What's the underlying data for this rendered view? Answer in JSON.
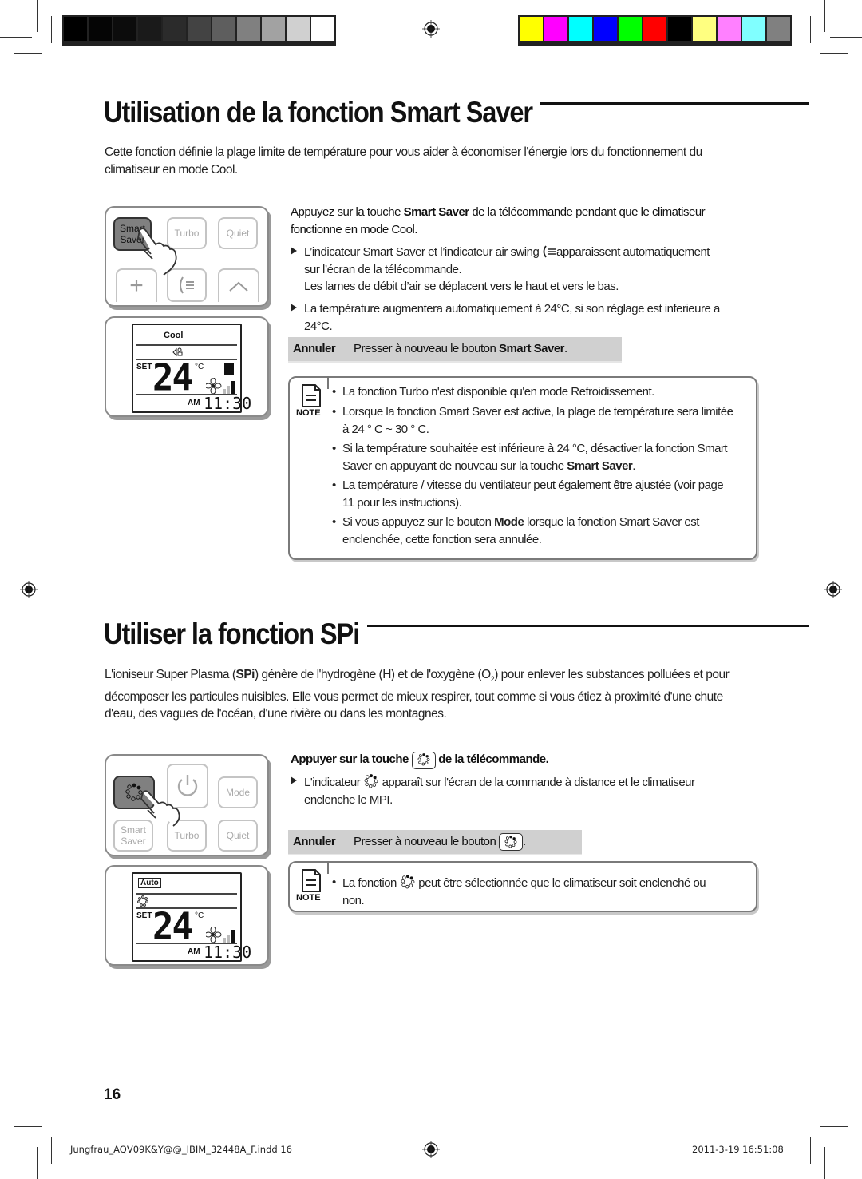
{
  "print_marks": {
    "grayscale_swatches": [
      "#000000",
      "#050505",
      "#0c0c0c",
      "#1a1a1a",
      "#2b2b2b",
      "#434343",
      "#5e5e5e",
      "#808080",
      "#a2a2a2",
      "#d0d0d0",
      "#ffffff"
    ],
    "color_swatches": [
      "#ffff00",
      "#ff00ff",
      "#00ffff",
      "#0000ff",
      "#00ff00",
      "#ff0000",
      "#000000",
      "#ffff80",
      "#ff80ff",
      "#80ffff",
      "#808080"
    ]
  },
  "section1": {
    "title": "Utilisation de la fonction Smart Saver",
    "intro_line1": "Cette fonction définie la plage limite de température pour vous aider à économiser l'énergie lors du fonctionnement du",
    "intro_line2": "climatiseur en mode Cool.",
    "remote": {
      "buttons": [
        {
          "label_line1": "Smart",
          "label_line2": "Saver",
          "pressed": true
        },
        {
          "label_line1": "Turbo",
          "label_line2": "",
          "pressed": false
        },
        {
          "label_line1": "Quiet",
          "label_line2": "",
          "pressed": false
        }
      ],
      "row2_icons": [
        "plus-icon",
        "air-swing-icon",
        "chevron-up-icon"
      ]
    },
    "display": {
      "mode": "Cool",
      "set_label": "SET",
      "temperature": "24",
      "unit": "°C",
      "am_label": "AM",
      "time": "11:30"
    },
    "step_heading_pre": "Appuyez sur la touche ",
    "step_heading_bold": "Smart Saver",
    "step_heading_post": " de la télécommande pendant que le climatiseur",
    "step_heading_line2": "fonctionne en mode Cool.",
    "bullet1_part1": "L’indicateur Smart Saver et l’indicateur air swing",
    "bullet1_part2": "apparaissent automatiquement",
    "bullet1_line2": "sur l’écran de la télécommande.",
    "bullet1_line3": "Les lames de débit d’air se déplacent vers le haut et vers le bas.",
    "bullet2_line1": "La température augmentera automatiquement à 24°C, si son réglage est inferieure a",
    "bullet2_line2": "24°C.",
    "cancel": {
      "label": "Annuler",
      "action_pre": "Presser à nouveau le bouton ",
      "action_bold": "Smart Saver",
      "action_post": "."
    },
    "note": {
      "label": "NOTE",
      "items": [
        {
          "l1": "La fonction Turbo n'est disponible qu'en mode Refroidissement."
        },
        {
          "l1": "Lorsque la fonction Smart Saver est active, la plage de température sera limitée",
          "l2": "à 24 ° C ~ 30 ° C."
        },
        {
          "l1": "Si la température souhaitée est inférieure à 24 °C, désactiver la fonction Smart",
          "l2_pre": "Saver en appuyant de nouveau sur la touche ",
          "l2_bold": "Smart Saver",
          "l2_post": "."
        },
        {
          "l1": "La température / vitesse du ventilateur peut également être ajustée (voir page",
          "l2": "11 pour les instructions)."
        },
        {
          "l1_pre": "Si vous appuyez sur le bouton ",
          "l1_bold": "Mode",
          "l1_post": " lorsque la fonction Smart Saver est",
          "l2": "enclenchée, cette fonction sera annulée."
        }
      ]
    }
  },
  "section2": {
    "title": "Utiliser la fonction SPi",
    "intro_line1_pre": "L'ioniseur Super Plasma (",
    "intro_line1_bold": "SPi",
    "intro_line1_post": ") génère de l'hydrogène (H) et de l'oxygène (O",
    "intro_sub": "2",
    "intro_line1_end": ") pour enlever les substances polluées et pour",
    "intro_line2": "décomposer les particules nuisibles. Elle vous permet de mieux respirer, tout comme si vous étiez à proximité d'une chute",
    "intro_line3": "d'eau, des vagues de l'océan, d'une rivière ou dans les montagnes.",
    "remote": {
      "buttons": [
        {
          "label_line1": "",
          "label_line2": "",
          "icon": "spi-icon",
          "pressed": true
        },
        {
          "label_line1": "",
          "label_line2": "",
          "icon": "power-icon",
          "pressed": false
        },
        {
          "label_line1": "Mode",
          "label_line2": "",
          "pressed": false
        },
        {
          "label_line1": "Smart",
          "label_line2": "Saver",
          "pressed": false
        },
        {
          "label_line1": "Turbo",
          "label_line2": "",
          "pressed": false
        },
        {
          "label_line1": "Quiet",
          "label_line2": "",
          "pressed": false
        }
      ]
    },
    "display": {
      "mode": "Auto",
      "set_label": "SET",
      "temperature": "24",
      "unit": "°C",
      "am_label": "AM",
      "time": "11:30"
    },
    "step_heading_pre": "Appuyer sur la touche",
    "step_heading_post": "de la télécommande.",
    "bullet1_pre": "L'indicateur",
    "bullet1_post": "apparaît sur l'écran de la commande à distance et le climatiseur",
    "bullet1_line2": "enclenche le MPI.",
    "cancel": {
      "label": "Annuler",
      "action_pre": "Presser à nouveau le bouton",
      "action_post": "."
    },
    "note": {
      "label": "NOTE",
      "item_pre": "La fonction",
      "item_post": "peut être sélectionnée que le climatiseur soit enclenché ou",
      "item_line2": "non."
    }
  },
  "page_number": "16",
  "footer": {
    "file": "Jungfrau_AQV09K&Y@@_IBIM_32448A_F.indd   16",
    "timestamp": "2011-3-19   16:51:08"
  }
}
